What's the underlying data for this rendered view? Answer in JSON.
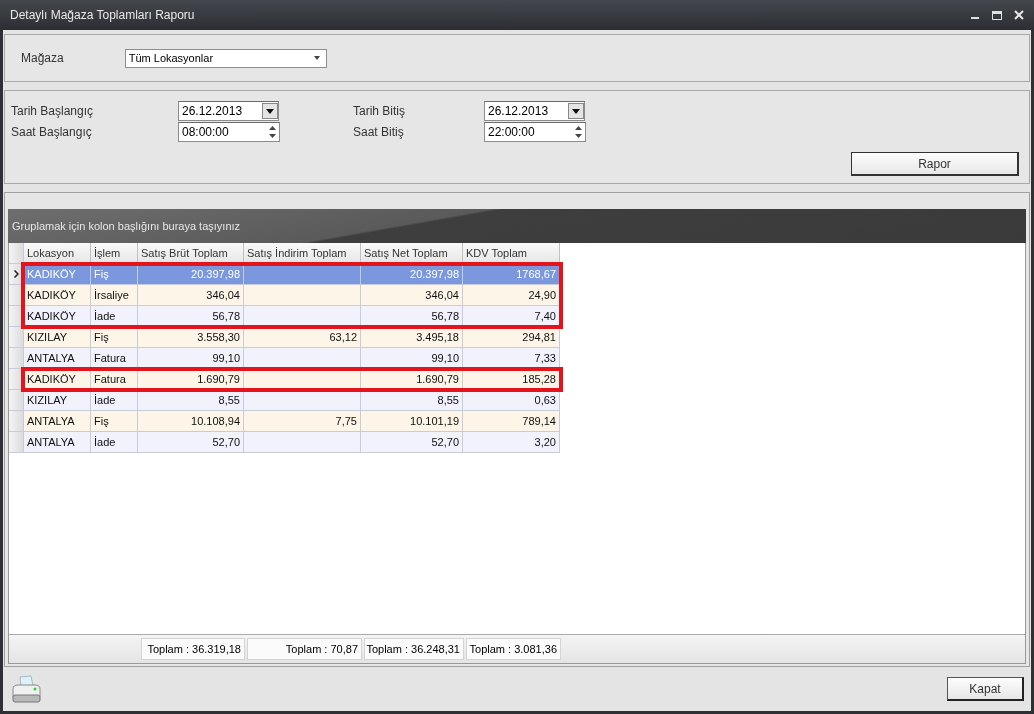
{
  "window": {
    "title": "Detaylı Mağaza Toplamları Raporu"
  },
  "store_filter": {
    "label": "Mağaza",
    "value": "Tüm Lokasyonlar"
  },
  "date_filters": [
    {
      "label": "Tarih Başlangıç",
      "value": "26.12.2013",
      "kind": "date"
    },
    {
      "label": "Tarih Bitiş",
      "value": "26.12.2013",
      "kind": "date"
    },
    {
      "label": "Saat Başlangıç",
      "value": "08:00:00",
      "kind": "time"
    },
    {
      "label": "Saat Bitiş",
      "value": "22:00:00",
      "kind": "time"
    }
  ],
  "report_button": "Rapor",
  "grid": {
    "group_panel_hint": "Gruplamak için kolon başlığını buraya taşıyınız",
    "columns": [
      {
        "label": "Lokasyon",
        "kind": "text"
      },
      {
        "label": "İşlem",
        "kind": "text"
      },
      {
        "label": "Satış Brüt Toplam",
        "kind": "number"
      },
      {
        "label": "Satış İndirim Toplam",
        "kind": "number"
      },
      {
        "label": "Satış Net Toplam",
        "kind": "number"
      },
      {
        "label": "KDV Toplam",
        "kind": "number"
      }
    ],
    "rows": [
      {
        "cells": [
          "KADIKÖY",
          "Fiş",
          "20.397,98",
          "",
          "20.397,98",
          "1768,67"
        ],
        "selected": true,
        "outlined": true
      },
      {
        "cells": [
          "KADIKÖY",
          "İrsaliye",
          "346,04",
          "",
          "346,04",
          "24,90"
        ],
        "selected": false,
        "outlined": true
      },
      {
        "cells": [
          "KADIKÖY",
          "İade",
          "56,78",
          "",
          "56,78",
          "7,40"
        ],
        "selected": false,
        "outlined": true
      },
      {
        "cells": [
          "KIZILAY",
          "Fiş",
          "3.558,30",
          "63,12",
          "3.495,18",
          "294,81"
        ],
        "selected": false,
        "outlined": false
      },
      {
        "cells": [
          "ANTALYA",
          "Fatura",
          "99,10",
          "",
          "99,10",
          "7,33"
        ],
        "selected": false,
        "outlined": false
      },
      {
        "cells": [
          "KADIKÖY",
          "Fatura",
          "1.690,79",
          "",
          "1.690,79",
          "185,28"
        ],
        "selected": false,
        "outlined": true
      },
      {
        "cells": [
          "KIZILAY",
          "İade",
          "8,55",
          "",
          "8,55",
          "0,63"
        ],
        "selected": false,
        "outlined": false
      },
      {
        "cells": [
          "ANTALYA",
          "Fiş",
          "10.108,94",
          "7,75",
          "10.101,19",
          "789,14"
        ],
        "selected": false,
        "outlined": false
      },
      {
        "cells": [
          "ANTALYA",
          "İade",
          "52,70",
          "",
          "52,70",
          "3,20"
        ],
        "selected": false,
        "outlined": false
      }
    ],
    "summaries": [
      "Toplam : 36.319,18",
      "Toplam : 70,87",
      "Toplam : 36.248,31",
      "Toplam : 3.081,36"
    ]
  },
  "close_button": "Kapat"
}
